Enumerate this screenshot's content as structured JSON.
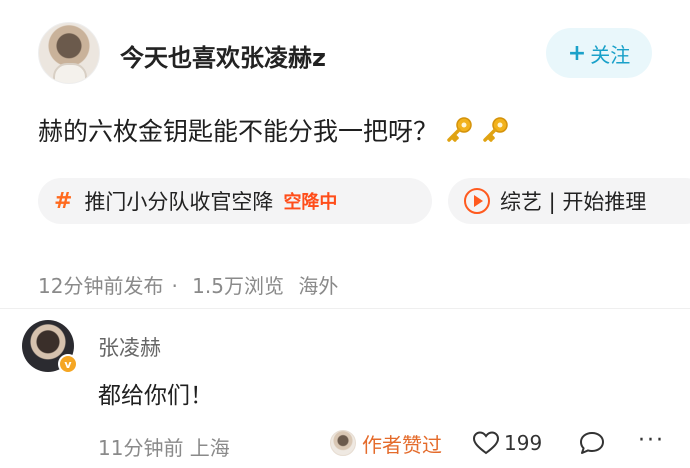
{
  "post": {
    "username": "今天也喜欢张凌赫z",
    "follow_plus": "+",
    "follow_label": "关注",
    "text": "赫的六枚金钥匙能不能分我一把呀？",
    "emoji": [
      "key-icon",
      "key-icon"
    ],
    "tags": [
      {
        "symbol": "#",
        "label": "推门小分队收官空降",
        "status": "空降中"
      },
      {
        "icon": "play-circle-icon",
        "label": "综艺 | 开始推理"
      }
    ],
    "meta": {
      "time": "12分钟前发布",
      "sep": "·",
      "views": "1.5万浏览",
      "location": "海外"
    }
  },
  "comment": {
    "name": "张凌赫",
    "verified_badge": "v",
    "text": "都给你们！",
    "time_location": "11分钟前  上海",
    "liked_label": "作者赞过",
    "like_count": "199",
    "more_label": "···"
  },
  "colors": {
    "follow_text": "#1aa1c9",
    "follow_bg": "#e9f7fb",
    "hash": "#ff6a1e",
    "status": "#ff4d1a",
    "author_liked": "#e46b2b",
    "key": "#f2b21c"
  }
}
